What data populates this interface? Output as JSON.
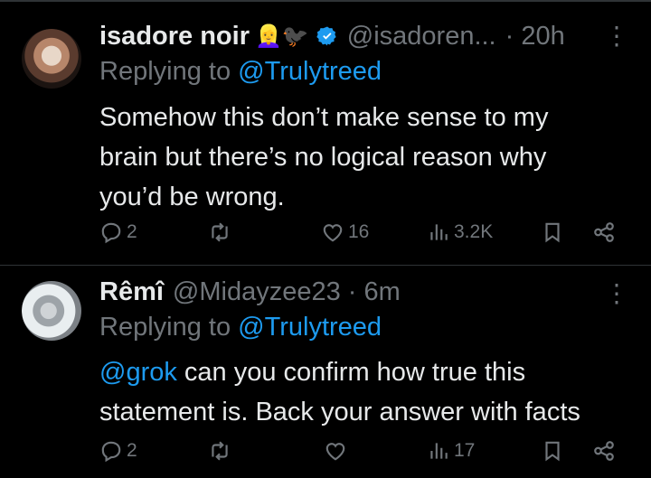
{
  "tweets": [
    {
      "name": "isadore noir",
      "emoji": "👱‍♀️🐦‍⬛",
      "handle": "@isadoren...",
      "time": "· 20h",
      "replying_prefix": "Replying to ",
      "replying_to": "@Trulytreed",
      "body_lines": [
        "Somehow this don’t make sense to my",
        "brain but there’s no logical reason why",
        "you’d be wrong."
      ],
      "replies": "2",
      "reposts": "",
      "likes": "16",
      "views": "3.2K",
      "verified": true
    },
    {
      "name": "Rêmî",
      "handle": "@Midayzee23",
      "time": "· 6m",
      "replying_prefix": "Replying to ",
      "replying_to": "@Trulytreed",
      "body_mention": "@grok",
      "body_line1": " can you confirm how true this",
      "body_line2": "statement is. Back your answer with facts",
      "replies": "2",
      "reposts": "",
      "likes": "",
      "views": "17",
      "verified": false
    }
  ],
  "colors": {
    "accent": "#1d9bf0",
    "muted": "#71767b",
    "text": "#e7e9ea",
    "divider": "#2f3336"
  },
  "icons": [
    "reply-icon",
    "repost-icon",
    "like-icon",
    "views-icon",
    "bookmark-icon",
    "share-icon",
    "more-icon",
    "verified-badge-icon"
  ]
}
